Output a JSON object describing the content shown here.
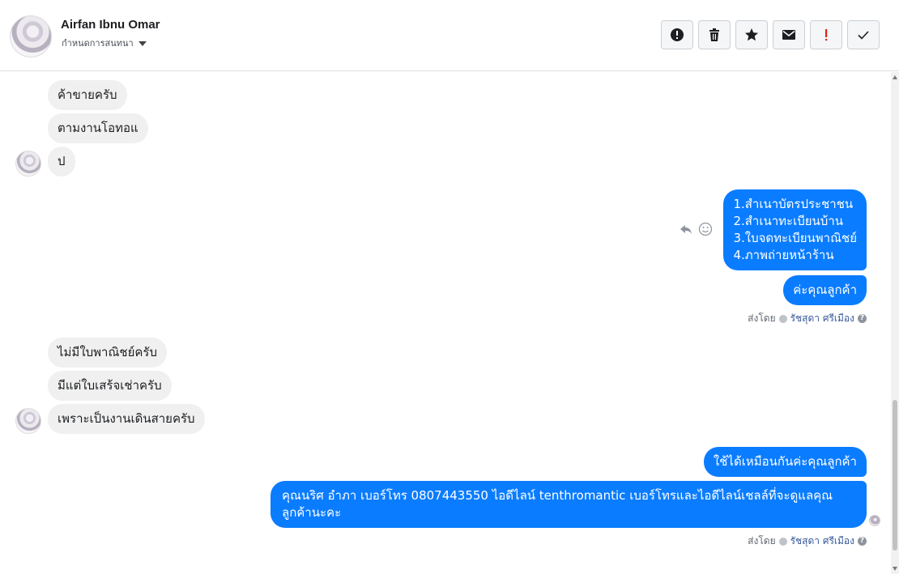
{
  "header": {
    "contact_name": "Airfan Ibnu Omar",
    "assign_label": "กำหนดการสนทนา",
    "toolbar": [
      {
        "name": "spam-button",
        "icon": "alert-circle-icon"
      },
      {
        "name": "delete-button",
        "icon": "trash-icon"
      },
      {
        "name": "follow-up-button",
        "icon": "star-icon"
      },
      {
        "name": "mark-unread-button",
        "icon": "envelope-icon"
      },
      {
        "name": "priority-button",
        "icon": "exclamation-icon"
      },
      {
        "name": "mark-done-button",
        "icon": "checkmark-icon"
      }
    ]
  },
  "messages": {
    "m1": "ค้าขายครับ",
    "m2": "ตามงานโอทอแ",
    "m3": "ป",
    "m4": "1.สำเนาบัตรประชาชน\n2.สำเนาทะเบียนบ้าน\n3.ใบจดทะเบียนพาณิชย์\n4.ภาพถ่ายหน้าร้าน",
    "m5": "ค่ะคุณลูกค้า",
    "m6": "ไม่มีใบพาณิชย์ครับ",
    "m7": "มีแต่ใบเสร้จเช่าครับ",
    "m8": "เพราะเป็นงานเดินสายครับ",
    "m9": "ใช้ได้เหมือนกันค่ะคุณลูกค้า",
    "m10": "คุณนริศ อำภา  เบอร์โทร 0807443550  ไอดีไลน์ tenthromantic    เบอร์โทรและไอดีไลน์เชลล์ที่จะดูแลคุณลูกค้านะคะ"
  },
  "sent_by": {
    "prefix": "ส่งโดย",
    "agent": "รัชสุดา ศรีเมือง",
    "help": "?"
  },
  "colors": {
    "outgoing_bubble": "#0a7cff",
    "incoming_bubble": "#f0f0f0",
    "agent_link": "#365899"
  }
}
